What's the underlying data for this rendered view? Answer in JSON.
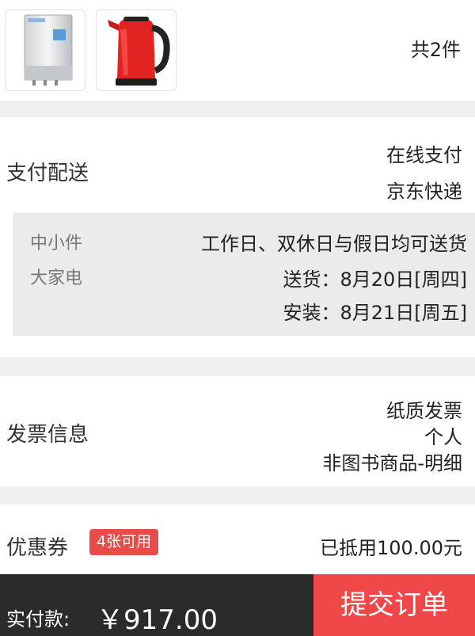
{
  "products": {
    "items": [
      {
        "name": "water-heater"
      },
      {
        "name": "electric-kettle"
      }
    ],
    "count_label": "共2件"
  },
  "payment_delivery": {
    "title": "支付配送",
    "payment_method": "在线支付",
    "delivery_method": "京东快递",
    "delivery_detail": {
      "categories": [
        "中小件",
        "大家电"
      ],
      "schedule": "工作日、双休日与假日均可送货",
      "delivery_date": "送货：8月20日[周四]",
      "install_date": "安装：8月21日[周五]"
    }
  },
  "invoice": {
    "title": "发票信息",
    "type": "纸质发票",
    "header": "个人",
    "content": "非图书商品-明细"
  },
  "coupon": {
    "title": "优惠券",
    "badge": "4张可用",
    "deducted": "已抵用100.00元"
  },
  "footer": {
    "pay_label": "实付款:",
    "amount": "￥917.00",
    "submit_label": "提交订单"
  },
  "colors": {
    "accent": "#f04848",
    "badge": "#e94b4b",
    "footer_bg": "#2b2b2b",
    "page_bg": "#efefef"
  }
}
